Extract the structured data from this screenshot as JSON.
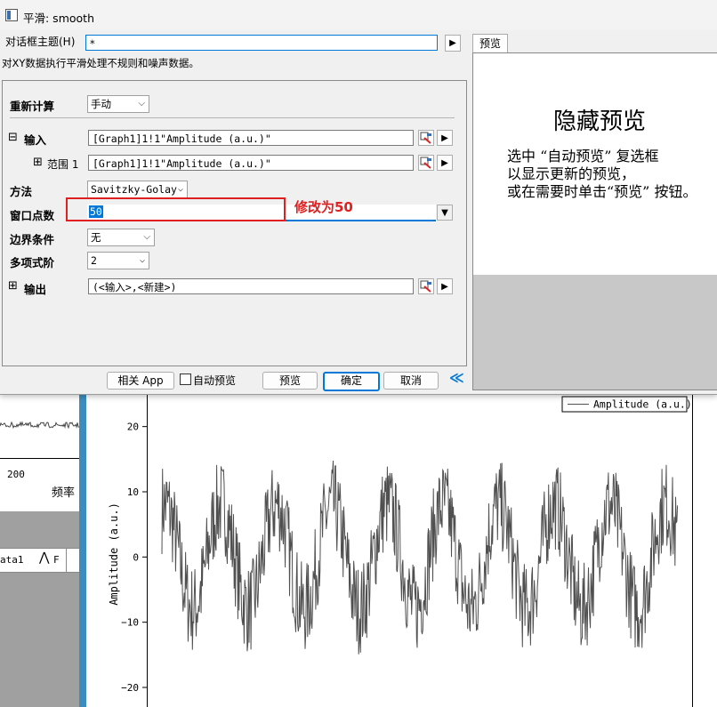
{
  "window": {
    "title": "平滑: smooth"
  },
  "dialog_theme": {
    "label": "对话框主题(H)",
    "value": "*"
  },
  "description": "对XY数据执行平滑处理不规则和噪声数据。",
  "preview_tab": {
    "label": "预览"
  },
  "preview": {
    "title": "隐藏预览",
    "line1": "选中 “自动预览” 复选框",
    "line2": "以显示更新的预览，",
    "line3": "或在需要时单击“预览” 按钮。"
  },
  "form": {
    "recalc": {
      "label": "重新计算",
      "value": "手动"
    },
    "input": {
      "label": "输入",
      "expander": "⊟",
      "value": "[Graph1]1!1\"Amplitude (a.u.)\""
    },
    "range": {
      "label": "范围 1",
      "expander": "⊞",
      "value": "[Graph1]1!1\"Amplitude (a.u.)\""
    },
    "method": {
      "label": "方法",
      "value": "Savitzky-Golay"
    },
    "window_points": {
      "label": "窗口点数",
      "value": "50"
    },
    "boundary": {
      "label": "边界条件",
      "value": "无"
    },
    "poly_order": {
      "label": "多项式阶",
      "value": "2"
    },
    "output": {
      "label": "输出",
      "expander": "⊞",
      "value": "(<输入>,<新建>)"
    }
  },
  "annotation": {
    "text": "修改为50",
    "color": "#e02020"
  },
  "buttons": {
    "related_app": "相关 App",
    "auto_preview": "自动预览",
    "preview": "预览",
    "ok": "确定",
    "cancel": "取消",
    "collapse": "≪"
  },
  "background": {
    "left_tick": "200",
    "left_xlabel": "频率",
    "left_tab1": "ata1",
    "left_tab2": "F"
  },
  "chart_data": {
    "type": "line",
    "ylabel": "Amplitude (a.u.)",
    "legend": "Amplitude (a.u.)",
    "legend_position": "top-right",
    "yticks": [
      "20",
      "10",
      "0",
      "-10",
      "-20"
    ],
    "ylim": [
      -23,
      25
    ],
    "series": [
      {
        "name": "Amplitude (a.u.)",
        "color": "#505050"
      }
    ]
  },
  "colors": {
    "accent": "#0078d7",
    "dialog_bg": "#f0f0f0",
    "highlight": "#0078d7"
  }
}
